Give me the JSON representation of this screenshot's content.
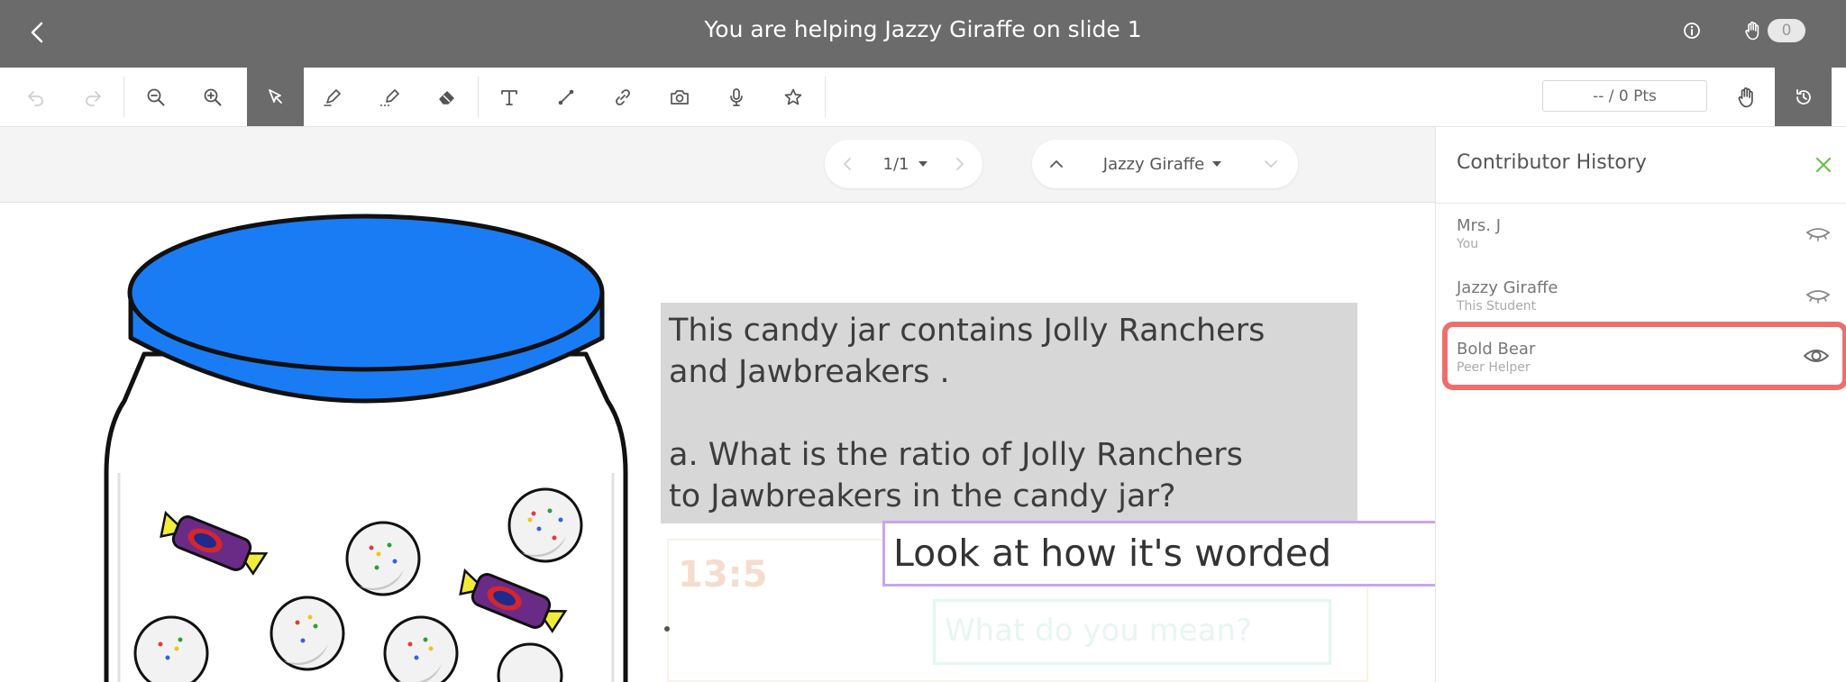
{
  "header": {
    "title": "You are helping Jazzy Giraffe on slide 1",
    "hand_count": "0"
  },
  "toolbar": {
    "points": "-- / 0 Pts"
  },
  "navigator": {
    "page": "1/1",
    "student": "Jazzy Giraffe"
  },
  "slide": {
    "question_lines": [
      "This candy jar contains Jolly Ranchers",
      "and Jawbreakers .",
      "a. What is the ratio of Jolly Ranchers",
      "to Jawbreakers in the candy jar?"
    ],
    "ghost_answer": "13:5",
    "ghost_reply": "What do you mean?",
    "comment": "Look at how it's worded"
  },
  "panel": {
    "title": "Contributor History",
    "contributors": [
      {
        "name": "Mrs. J",
        "role": "You",
        "visible": false
      },
      {
        "name": "Jazzy Giraffe",
        "role": "This Student",
        "visible": false
      },
      {
        "name": "Bold Bear",
        "role": "Peer Helper",
        "visible": true
      }
    ]
  },
  "colors": {
    "header_bg": "#6b6b6b",
    "jar_lid": "#1a7cf4",
    "highlight": "#ee6e6e",
    "comment_border": "#c9a5f0",
    "close_green": "#6cc04a"
  }
}
